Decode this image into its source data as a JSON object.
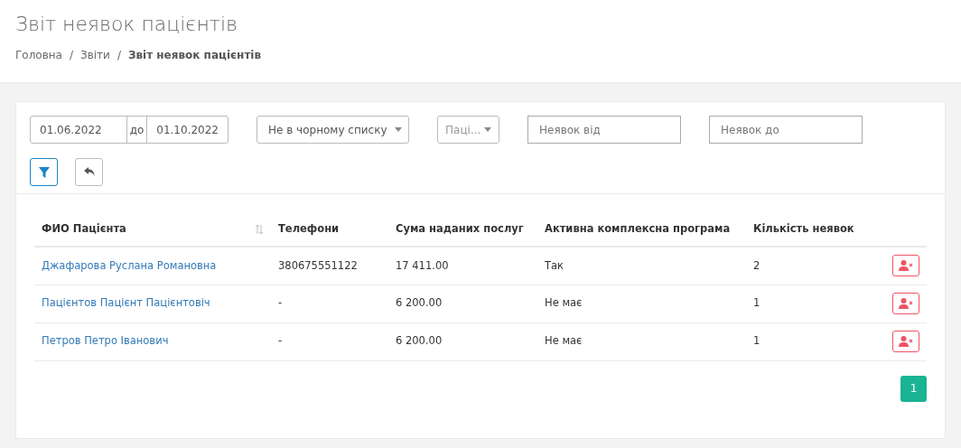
{
  "page": {
    "title": "Звіт неявок пацієнтів"
  },
  "breadcrumb_separator": "/",
  "breadcrumb": [
    {
      "label": "Головна",
      "current": false
    },
    {
      "label": "Звіти",
      "current": false
    },
    {
      "label": "Звіт неявок пацієнтів",
      "current": true
    }
  ],
  "filters": {
    "date_from": "01.06.2022",
    "date_separator": "до",
    "date_to": "01.10.2022",
    "blacklist_select": "Не в чорному списку",
    "patient_select": {
      "placeholder": "Паці..."
    },
    "absences_from": {
      "placeholder": "Неявок від"
    },
    "absences_to": {
      "placeholder": "Неявок до"
    }
  },
  "table": {
    "columns": [
      {
        "label": "ФИО Пацієнта",
        "sortable": true
      },
      {
        "label": "Телефони",
        "sortable": false
      },
      {
        "label": "Сума наданих послуг",
        "sortable": false
      },
      {
        "label": "Активна комплексна програма",
        "sortable": false
      },
      {
        "label": "Кількість неявок",
        "sortable": false
      }
    ],
    "rows": [
      {
        "name": "Джафарова Руслана Романовна",
        "phone": "380675551122",
        "sum": "17 411.00",
        "program": "Так",
        "absences": "2"
      },
      {
        "name": "Пацієнтов Пацієнт Пацієнтовіч",
        "phone": "-",
        "sum": "6 200.00",
        "program": "Не має",
        "absences": "1"
      },
      {
        "name": "Петров Петро Іванович",
        "phone": "-",
        "sum": "6 200.00",
        "program": "Не має",
        "absences": "1"
      }
    ]
  },
  "pagination": [
    {
      "label": "1",
      "selected": true
    }
  ]
}
